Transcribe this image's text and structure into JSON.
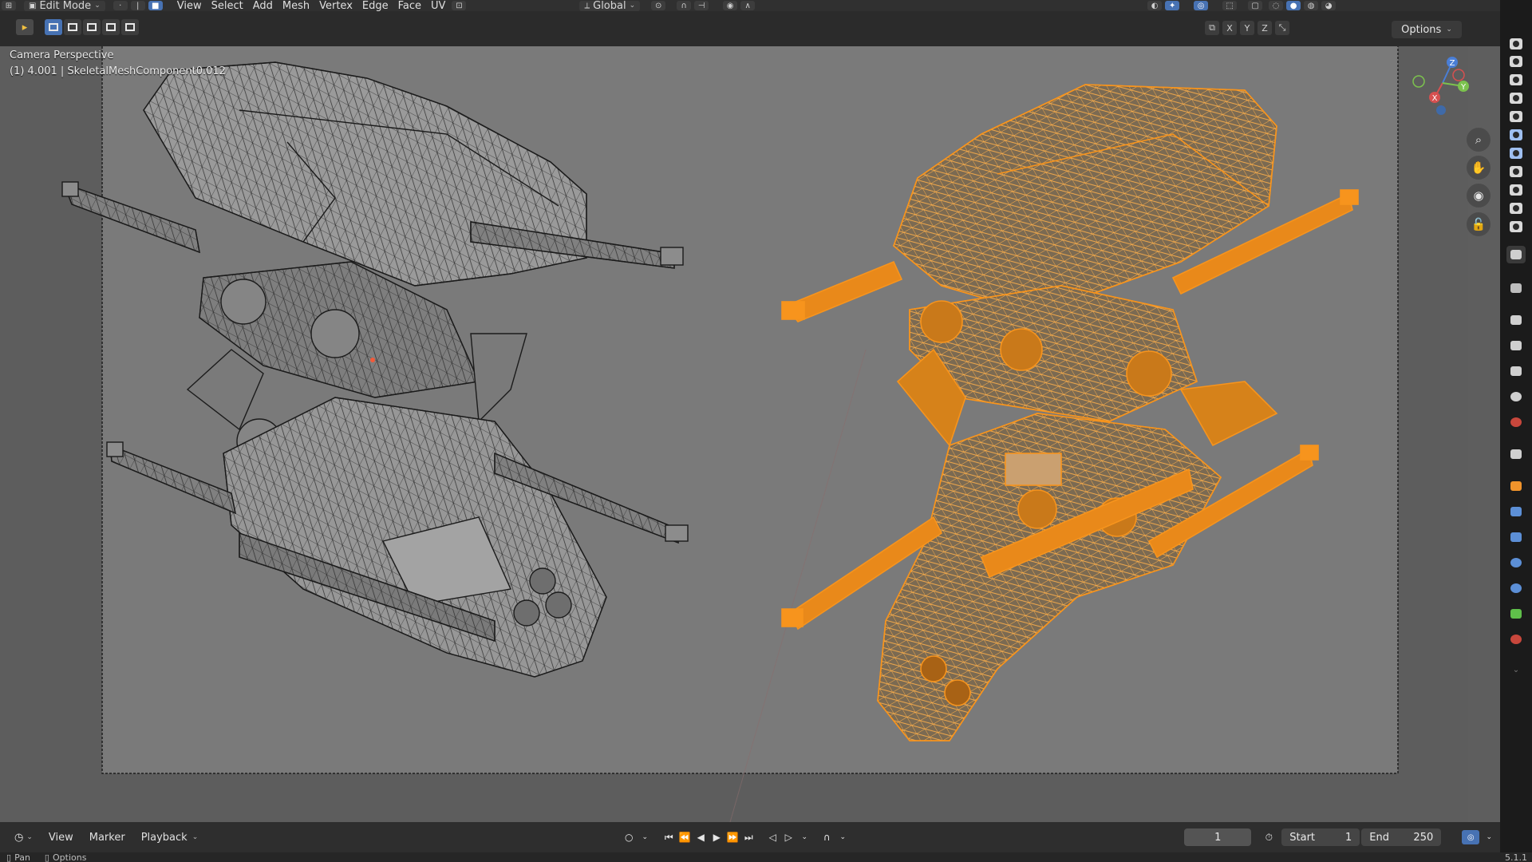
{
  "header": {
    "mode_label": "Edit Mode",
    "menus": [
      "View",
      "Select",
      "Add",
      "Mesh",
      "Vertex",
      "Edge",
      "Face",
      "UV"
    ],
    "transform_orientation": "Global"
  },
  "toolheader": {
    "axes": [
      "X",
      "Y",
      "Z"
    ],
    "options_label": "Options"
  },
  "viewport": {
    "view_name": "Camera Perspective",
    "object_info": "(1) 4.001 | SkeletalMeshComponent0.012",
    "gizmo_axes": [
      "Z",
      "X",
      "Y"
    ],
    "selection_color": "#f7941d",
    "wire_color": "#1a1a1a",
    "background_color": "#5e5e5e"
  },
  "timeline": {
    "menus": [
      "View",
      "Marker",
      "Playback"
    ],
    "current_frame": "1",
    "start_label": "Start",
    "start_value": "1",
    "end_label": "End",
    "end_value": "250"
  },
  "statusbar": {
    "items": [
      "Pan",
      "Options"
    ],
    "version": "5.1.1"
  }
}
